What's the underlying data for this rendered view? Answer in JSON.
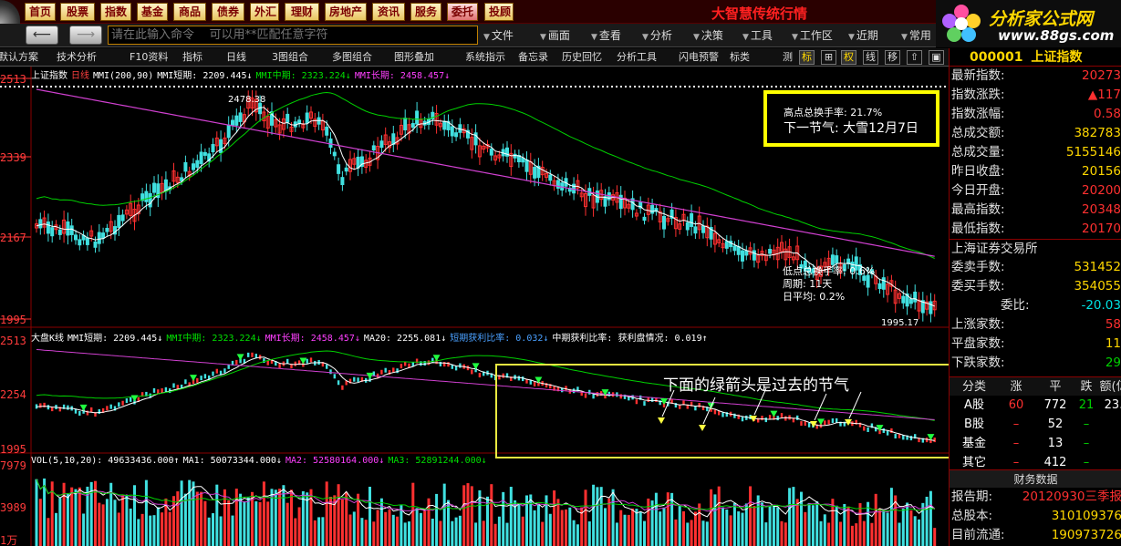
{
  "menu": {
    "items": [
      "首页",
      "股票",
      "指数",
      "基金",
      "商品",
      "债券",
      "外汇",
      "理财",
      "房地产",
      "资讯",
      "服务",
      "委托",
      "投顾"
    ],
    "active": "委托",
    "app_title": "大智慧传统行情"
  },
  "command_bar": {
    "back_icon": "back-arrow-icon",
    "forward_icon": "forward-arrow-icon",
    "input_placeholder": "请在此输入命令    可以用**匹配任意字符",
    "menus": [
      "文件",
      "画面",
      "查看",
      "分析",
      "决策",
      "工具",
      "工作区",
      "近期",
      "常用"
    ]
  },
  "brand": {
    "name": "分析家公式网",
    "url": "www.88gs.com"
  },
  "toolbar": {
    "items": [
      "默认方案",
      "技术分析",
      "F10资料",
      "指标",
      "日线",
      "3图组合",
      "多图组合",
      "图形叠加",
      "系统指示",
      "备忘录",
      "历史回忆",
      "分析工具",
      "闪电预警",
      "标类",
      "测"
    ],
    "squares": [
      "标",
      "⊞",
      "权",
      "线",
      "移",
      "⇧",
      "▣"
    ]
  },
  "upper_chart": {
    "title": "上证指数",
    "period": "日线",
    "legend": [
      {
        "text": "MMI(200,90)",
        "color": "#ffffff"
      },
      {
        "text": "MMI短期: 2209.445↓",
        "color": "#ffffff"
      },
      {
        "text": "MMI中期: 2323.224↓",
        "color": "#00e000"
      },
      {
        "text": "MMI长期: 2458.457↓",
        "color": "#ff40ff"
      }
    ],
    "y_labels": [
      "2513",
      "2339",
      "2167",
      "1995"
    ],
    "high_label": "2478.38",
    "low_label": "1995.17"
  },
  "middle_chart": {
    "legend": [
      {
        "text": "大盘K线",
        "color": "#ffffff"
      },
      {
        "text": "MMI短期: 2209.445↓",
        "color": "#ffffff"
      },
      {
        "text": "MMI中期: 2323.224↓",
        "color": "#00e000"
      },
      {
        "text": "MMI长期: 2458.457↓",
        "color": "#ff40ff"
      },
      {
        "text": "MA20: 2255.081↓",
        "color": "#ffffff"
      },
      {
        "text": "短期获利比率: 0.032↓",
        "color": "#4aa0ff"
      },
      {
        "text": "中期获利比率: 获利盘情况: 0.019↑",
        "color": "#ffffff"
      }
    ],
    "y_labels": [
      "2513",
      "2254",
      "1995"
    ]
  },
  "volume_chart": {
    "legend": [
      {
        "text": "VOL(5,10,20): 49633436.000↑",
        "color": "#ffffff"
      },
      {
        "text": "MA1: 50073344.000↓",
        "color": "#ffffff"
      },
      {
        "text": "MA2: 52580164.000↓",
        "color": "#ff40ff"
      },
      {
        "text": "MA3: 52891244.000↓",
        "color": "#00e000"
      }
    ],
    "y_labels": [
      "7979",
      "3989",
      "1万"
    ]
  },
  "annotations": {
    "box1_line1": "高点总换手率: 21.7%",
    "box1_line2": "下一节气: 大雪12月7日",
    "low_line1": "低点总换手率: 0.6%",
    "low_line2": "周期: 11天",
    "low_line3": "日平均: 0.2%",
    "box2_text": "下面的绿箭头是过去的节气"
  },
  "quote_panel": {
    "code": "000001",
    "name": "上证指数",
    "rows": [
      {
        "k": "最新指数:",
        "v": "20273",
        "c": "red"
      },
      {
        "k": "指数涨跌:",
        "v": "▲117",
        "c": "red"
      },
      {
        "k": "指数涨幅:",
        "v": "0.58",
        "c": "red"
      },
      {
        "k": "总成交额:",
        "v": "382783",
        "c": "yel"
      },
      {
        "k": "总成交量:",
        "v": "5155146",
        "c": "yel"
      },
      {
        "k": "昨日收盘:",
        "v": "20156",
        "c": "yel"
      },
      {
        "k": "今日开盘:",
        "v": "20200",
        "c": "red"
      },
      {
        "k": "最高指数:",
        "v": "20348",
        "c": "red"
      },
      {
        "k": "最低指数:",
        "v": "20170",
        "c": "red"
      }
    ],
    "exchange": "上海证券交易所",
    "rows2": [
      {
        "k": "委卖手数:",
        "v": "531452",
        "c": "yel"
      },
      {
        "k": "委买手数:",
        "v": "354055",
        "c": "yel"
      },
      {
        "k": "委比:",
        "v": "-20.03",
        "c": "cyan"
      },
      {
        "k": "上涨家数:",
        "v": "58",
        "c": "red"
      },
      {
        "k": "平盘家数:",
        "v": "11",
        "c": "yel"
      },
      {
        "k": "下跌家数:",
        "v": "29",
        "c": "grn"
      }
    ],
    "cat_headers": [
      "分类",
      "涨",
      "平",
      "跌",
      "额(亿"
    ],
    "cat_rows": [
      {
        "name": "A股",
        "up": "60",
        "flat": "772",
        "down": "21",
        "amt": "23."
      },
      {
        "name": "B股",
        "up": "–",
        "flat": "52",
        "down": "–",
        "amt": ""
      },
      {
        "name": "基金",
        "up": "–",
        "flat": "13",
        "down": "–",
        "amt": ""
      },
      {
        "name": "其它",
        "up": "–",
        "flat": "412",
        "down": "–",
        "amt": ""
      }
    ],
    "fin_title": "财务数据",
    "fin_rows": [
      {
        "k": "报告期:",
        "v": "20120930三季报",
        "c": "red"
      },
      {
        "k": "总股本:",
        "v": "310109376",
        "c": "yel"
      },
      {
        "k": "目前流通:",
        "v": "190973726",
        "c": "yel"
      }
    ]
  },
  "colors": {
    "short_line": "#ffffff",
    "mid_line": "#00d000",
    "long_line": "#d040d0",
    "candle_up": "#ff3030",
    "candle_down": "#40e0e0",
    "panel_border": "#8a0000"
  }
}
